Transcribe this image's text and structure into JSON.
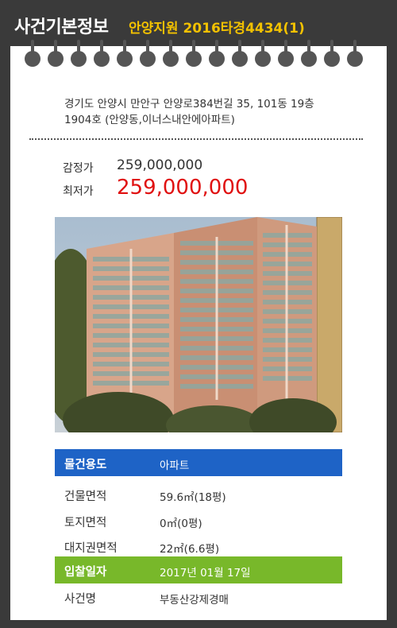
{
  "header": {
    "title": "사건기본정보",
    "case_info": "안양지원 2016타경4434(1)"
  },
  "property": {
    "address": "경기도 안양시 만안구 안양로384번길 35, 101동 19층1904호 (안양동,이너스내안에아파트)",
    "appraisal_label": "감정가",
    "appraisal_value": "259,000,000",
    "min_bid_label": "최저가",
    "min_bid_value": "259,000,000"
  },
  "details": {
    "rows": [
      {
        "label": "물건용도",
        "value": "아파트"
      },
      {
        "label": "건물면적",
        "value": "59.6㎡(18평)"
      },
      {
        "label": "토지면적",
        "value": "0㎡(0평)"
      },
      {
        "label": "대지권면적",
        "value": "22㎡(6.6평)"
      },
      {
        "label": "입찰일자",
        "value": "2017년 01월 17일"
      },
      {
        "label": "사건명",
        "value": "부동산강제경매"
      }
    ]
  },
  "colors": {
    "background": "#3a3a3a",
    "accent_yellow": "#f2c100",
    "price_red": "#e01010",
    "row_blue": "#1e63c6",
    "row_green": "#78b82a"
  }
}
